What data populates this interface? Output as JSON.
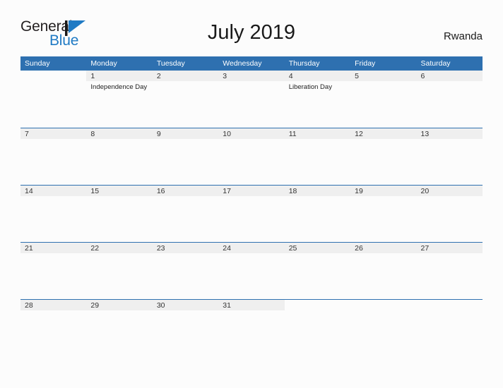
{
  "brand": {
    "name_part1": "General",
    "name_part2": "Blue",
    "mark_icon": "blue-flag-triangle-icon",
    "color_primary": "#1f7ac4",
    "color_text": "#231f20"
  },
  "header": {
    "title": "July 2019",
    "country": "Rwanda"
  },
  "theme": {
    "header_blue": "#2e70b0",
    "band_gray": "#efefef",
    "page_background": "#fcfcfc",
    "rule_blue": "#2e70b0"
  },
  "calendar": {
    "month": "July",
    "year": "2019",
    "weekday_headers": [
      "Sunday",
      "Monday",
      "Tuesday",
      "Wednesday",
      "Thursday",
      "Friday",
      "Saturday"
    ],
    "weeks": [
      [
        {
          "date": "",
          "events": []
        },
        {
          "date": "1",
          "events": [
            "Independence Day"
          ]
        },
        {
          "date": "2",
          "events": []
        },
        {
          "date": "3",
          "events": []
        },
        {
          "date": "4",
          "events": [
            "Liberation Day"
          ]
        },
        {
          "date": "5",
          "events": []
        },
        {
          "date": "6",
          "events": []
        }
      ],
      [
        {
          "date": "7",
          "events": []
        },
        {
          "date": "8",
          "events": []
        },
        {
          "date": "9",
          "events": []
        },
        {
          "date": "10",
          "events": []
        },
        {
          "date": "11",
          "events": []
        },
        {
          "date": "12",
          "events": []
        },
        {
          "date": "13",
          "events": []
        }
      ],
      [
        {
          "date": "14",
          "events": []
        },
        {
          "date": "15",
          "events": []
        },
        {
          "date": "16",
          "events": []
        },
        {
          "date": "17",
          "events": []
        },
        {
          "date": "18",
          "events": []
        },
        {
          "date": "19",
          "events": []
        },
        {
          "date": "20",
          "events": []
        }
      ],
      [
        {
          "date": "21",
          "events": []
        },
        {
          "date": "22",
          "events": []
        },
        {
          "date": "23",
          "events": []
        },
        {
          "date": "24",
          "events": []
        },
        {
          "date": "25",
          "events": []
        },
        {
          "date": "26",
          "events": []
        },
        {
          "date": "27",
          "events": []
        }
      ],
      [
        {
          "date": "28",
          "events": []
        },
        {
          "date": "29",
          "events": []
        },
        {
          "date": "30",
          "events": []
        },
        {
          "date": "31",
          "events": []
        },
        {
          "date": "",
          "events": []
        },
        {
          "date": "",
          "events": []
        },
        {
          "date": "",
          "events": []
        }
      ]
    ]
  }
}
